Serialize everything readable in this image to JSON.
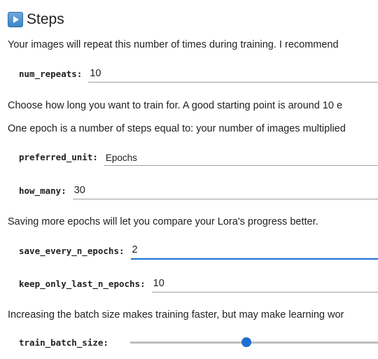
{
  "section": {
    "title": "Steps",
    "icon": "play-button-icon"
  },
  "paragraphs": {
    "repeat_info": "Your images will repeat this number of times during training. I recommend",
    "duration_info": "Choose how long you want to train for. A good starting point is around 10 e",
    "epoch_info": "One epoch is a number of steps equal to: your number of images multiplied",
    "save_info": "Saving more epochs will let you compare your Lora's progress better.",
    "batch_info": "Increasing the batch size makes training faster, but may make learning wor"
  },
  "fields": {
    "num_repeats": {
      "label": "num_repeats:",
      "value": "10"
    },
    "preferred_unit": {
      "label": "preferred_unit:",
      "value": "Epochs"
    },
    "how_many": {
      "label": "how_many:",
      "value": "30"
    },
    "save_every_n_epochs": {
      "label": "save_every_n_epochs:",
      "value": "2"
    },
    "keep_only_last_n_epochs": {
      "label": "keep_only_last_n_epochs:",
      "value": "10"
    },
    "train_batch_size": {
      "label": "train_batch_size:",
      "slider_fraction": 0.47
    }
  },
  "colors": {
    "accent": "#1e6fd0",
    "underline": "#9e9e9e",
    "text": "#212121"
  }
}
